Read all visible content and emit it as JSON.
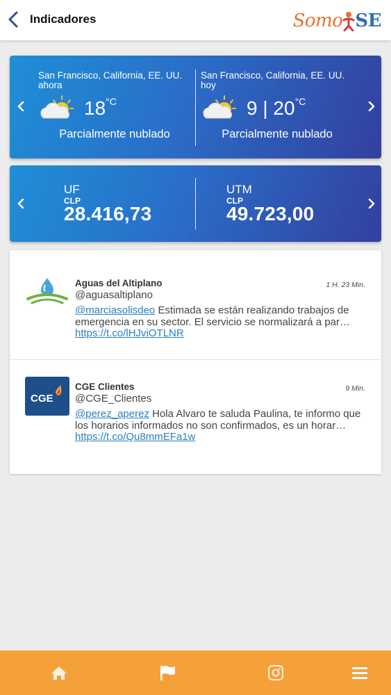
{
  "header": {
    "title": "Indicadores",
    "logo_text": "Somo",
    "logo_text_end": "SE"
  },
  "weather": [
    {
      "location": "San Francisco, California, EE. UU. ahora",
      "temp": "18",
      "unit": "°C",
      "description": "Parcialmente nublado"
    },
    {
      "location": "San Francisco, California, EE. UU. hoy",
      "temp": "9 | 20",
      "unit": "°C",
      "description": "Parcialmente nublado"
    }
  ],
  "indicators": [
    {
      "name": "UF",
      "currency": "CLP",
      "value": "28.416,73"
    },
    {
      "name": "UTM",
      "currency": "CLP",
      "value": "49.723,00"
    }
  ],
  "tweets": [
    {
      "name": "Aguas del Altiplano",
      "handle": "@aguasaltiplano",
      "time": "1 H. 23 Min.",
      "mention": "@marciasolisdeo",
      "text": " Estimada se están realizando trabajos de emergencia en su sector. El servicio se normalizará a par… ",
      "link": "https://t.co/lHJviOTLNR",
      "avatar": "aguas-altiplano-logo"
    },
    {
      "name": "CGE Clientes",
      "handle": "@CGE_Clientes",
      "time": "9 Min.",
      "mention": "@perez_aperez",
      "text": " Hola Alvaro te saluda Paulina, te informo que los horarios informados no son confirmados, es un horar… ",
      "link": "https://t.co/Qu8mmEFa1w",
      "avatar_text": "CGE"
    }
  ],
  "nav": [
    "home-icon",
    "flag-icon",
    "instagram-icon",
    "menu-icon"
  ],
  "colors": {
    "accent": "#f5a13a",
    "card_start": "#1e8fd6",
    "card_end": "#33409f",
    "link": "#2a7fc1"
  }
}
